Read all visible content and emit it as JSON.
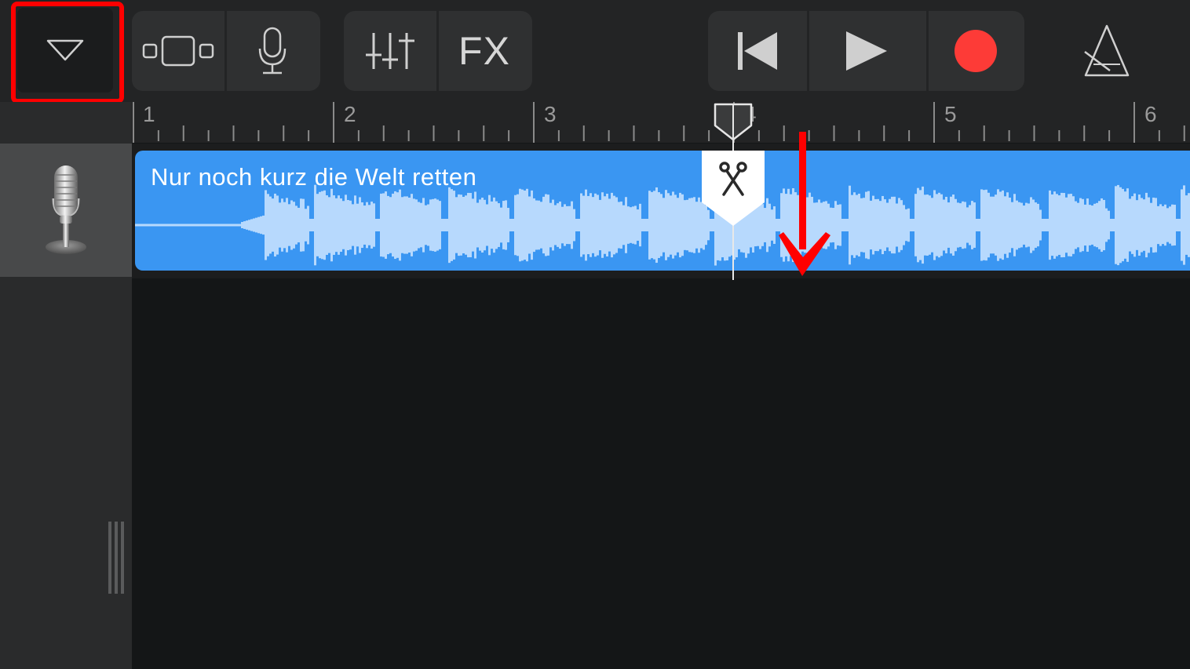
{
  "toolbar": {
    "dropdown_icon": "triangle-down-icon",
    "view_toggle_icon": "tracks-view-icon",
    "mic_icon": "microphone-icon",
    "mixer_icon": "mixer-sliders-icon",
    "fx_label": "FX",
    "rewind_icon": "skip-back-icon",
    "play_icon": "play-icon",
    "record_icon": "record-icon",
    "metronome_icon": "metronome-icon",
    "record_color": "#fd3b37",
    "highlight_color": "#ff0000"
  },
  "ruler": {
    "bars": [
      "1",
      "2",
      "3",
      "4",
      "5",
      "6"
    ]
  },
  "track": {
    "instrument_icon": "vintage-microphone-icon",
    "region": {
      "title": "Nur noch kurz die Welt retten",
      "color": "#3a96f2",
      "waveform_color": "#b7d9fd"
    },
    "split_icon": "scissors-icon"
  },
  "annotation": {
    "arrow_color": "#ff0000"
  }
}
